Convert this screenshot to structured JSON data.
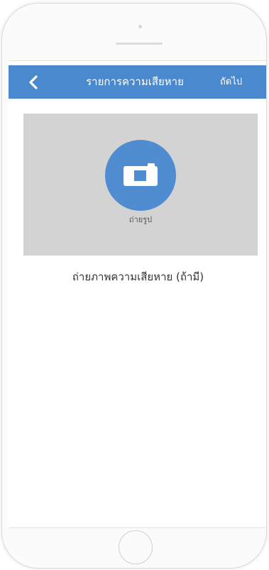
{
  "header": {
    "back_icon": "chevron-left-icon",
    "title": "รายการความเสียหาย",
    "next_label": "ถัดไป"
  },
  "photo": {
    "icon": "camera-icon",
    "label": "ถ่ายรูป",
    "caption": "ถ่ายภาพความเสียหาย (ถ้ามี)"
  },
  "colors": {
    "accent": "#4a89cd",
    "camera_circle": "#4f8dd0",
    "photo_bg": "#d3d3d3"
  }
}
